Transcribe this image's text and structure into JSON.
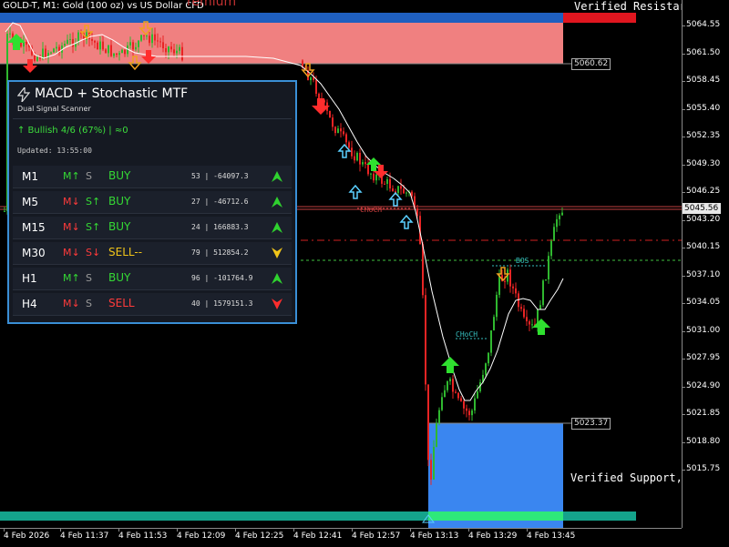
{
  "chart": {
    "title": "GOLD-T, M1:  Gold (100 oz) vs US Dollar CFD",
    "premium_label": "remium",
    "verified_resistance": "Verified Resistar",
    "verified_support": "Verified Support,",
    "level_upper": "5060.62",
    "level_lower": "5023.37",
    "current_price": "5045.56",
    "choch_1": "CHoCH",
    "choch_2": "CHoCH",
    "bos": "BOS",
    "colors": {
      "premium_zone": "#f08080",
      "blue_band": "#1f5fbf",
      "support_zone": "#3a86f0",
      "teal_band": "#14a38b",
      "bull_candle": "#2fb82f",
      "bear_candle": "#e82424"
    }
  },
  "price_scale": [
    "5064.55",
    "5061.50",
    "5058.45",
    "5055.40",
    "5052.35",
    "5049.30",
    "5046.25",
    "5043.20",
    "5040.15",
    "5037.10",
    "5034.05",
    "5031.00",
    "5027.95",
    "5024.90",
    "5021.85",
    "5018.80",
    "5015.75"
  ],
  "time_scale": [
    "4 Feb 2026",
    "4 Feb 11:37",
    "4 Feb 11:53",
    "4 Feb 12:09",
    "4 Feb 12:25",
    "4 Feb 12:41",
    "4 Feb 12:57",
    "4 Feb 13:13",
    "4 Feb 13:29",
    "4 Feb 13:45"
  ],
  "panel": {
    "icon": "lightning-icon",
    "title": "MACD + Stochastic MTF",
    "subtitle": "Dual Signal Scanner",
    "bullish": "↑ Bullish 4/6 (67%) | ≈0",
    "updated": "Updated: 13:55:00",
    "rows": [
      {
        "tf": "M1",
        "m": "M↑",
        "s": "S",
        "signal": "BUY",
        "values": "53 | -64097.3",
        "arrow": "up"
      },
      {
        "tf": "M5",
        "m": "M↓",
        "s": "S↑",
        "signal": "BUY",
        "values": "27 | -46712.6",
        "arrow": "up"
      },
      {
        "tf": "M15",
        "m": "M↓",
        "s": "S↑",
        "signal": "BUY",
        "values": "24 | 166883.3",
        "arrow": "up"
      },
      {
        "tf": "M30",
        "m": "M↓",
        "s": "S↓",
        "signal": "SELL--",
        "values": "79 | 512854.2",
        "arrow": "down-weak"
      },
      {
        "tf": "H1",
        "m": "M↑",
        "s": "S",
        "signal": "BUY",
        "values": "96 | -101764.9",
        "arrow": "up"
      },
      {
        "tf": "H4",
        "m": "M↓",
        "s": "S",
        "signal": "SELL",
        "values": "40 | 1579151.3",
        "arrow": "down"
      }
    ]
  }
}
